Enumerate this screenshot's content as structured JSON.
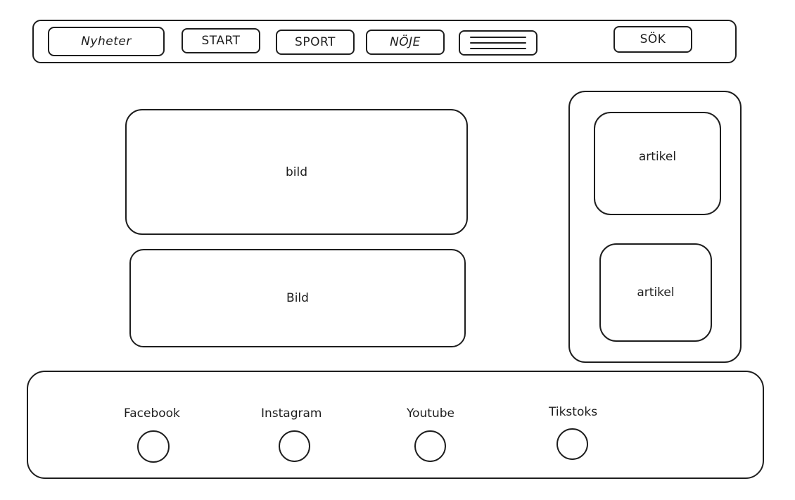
{
  "header": {
    "nyheter_label": "Nyheter",
    "start_label": "START",
    "sport_label": "SPORT",
    "noje_label": "NÖJE",
    "menu_icon": "hamburger-menu-icon",
    "search_label": "SÖK"
  },
  "main": {
    "image1_label": "bild",
    "image2_label": "Bild"
  },
  "sidebar": {
    "article1_label": "artikel",
    "article2_label": "artikel"
  },
  "footer": {
    "links": [
      {
        "label": "Facebook",
        "icon": "circle-icon"
      },
      {
        "label": "Instagram",
        "icon": "circle-icon"
      },
      {
        "label": "Youtube",
        "icon": "circle-icon"
      },
      {
        "label": "Tikstoks",
        "icon": "circle-icon"
      }
    ]
  }
}
